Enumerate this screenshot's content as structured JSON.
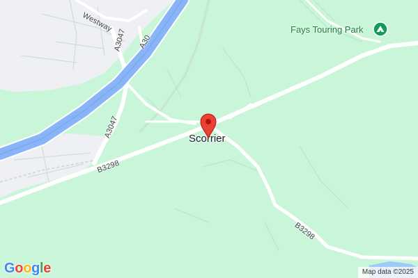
{
  "map": {
    "place": {
      "name": "Scorrier"
    },
    "poi": {
      "name": "Fays Touring Park",
      "icon": "campground-icon",
      "color": "#0f9d58"
    },
    "roads": {
      "westway": "Westway",
      "a3047_north": "A3047",
      "a30": "A30",
      "a3047_south": "A3047",
      "b3298_west": "B3298",
      "b3298_south": "B3298"
    },
    "marker": {
      "icon": "map-pin-icon",
      "color": "#ea4335"
    },
    "attribution": "Map data ©2025",
    "logo": {
      "text": "Google",
      "letters": [
        {
          "ch": "G",
          "color": "#4285f4"
        },
        {
          "ch": "o",
          "color": "#ea4335"
        },
        {
          "ch": "o",
          "color": "#fbbc05"
        },
        {
          "ch": "g",
          "color": "#4285f4"
        },
        {
          "ch": "l",
          "color": "#34a853"
        },
        {
          "ch": "e",
          "color": "#ea4335"
        }
      ]
    },
    "colors": {
      "land": "#c9f5d8",
      "urban": "#eef0f3",
      "motorway": "#8ab4f8",
      "road": "#ffffff"
    }
  }
}
